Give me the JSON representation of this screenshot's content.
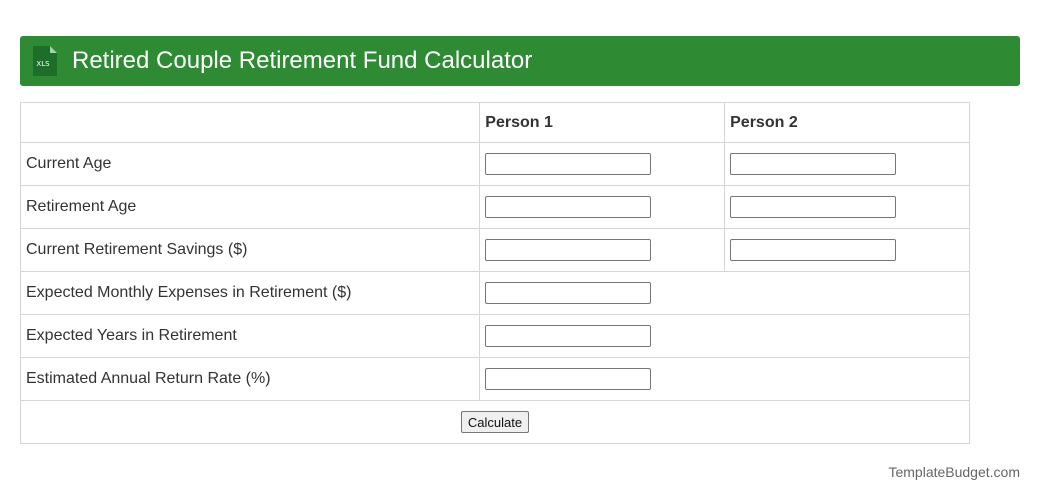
{
  "header": {
    "title": "Retired Couple Retirement Fund Calculator",
    "icon": "xls-file-icon",
    "icon_text": "XLS",
    "bg_color": "#2f8a34"
  },
  "table": {
    "columns": [
      "",
      "Person 1",
      "Person 2"
    ],
    "rows": [
      {
        "label": "Current Age",
        "person1_value": "",
        "person2_value": ""
      },
      {
        "label": "Retirement Age",
        "person1_value": "",
        "person2_value": ""
      },
      {
        "label": "Current Retirement Savings ($)",
        "person1_value": "",
        "person2_value": ""
      },
      {
        "label": "Expected Monthly Expenses in Retirement ($)",
        "value": ""
      },
      {
        "label": "Expected Years in Retirement",
        "value": ""
      },
      {
        "label": "Estimated Annual Return Rate (%)",
        "value": ""
      }
    ]
  },
  "actions": {
    "calculate_label": "Calculate"
  },
  "footer": {
    "credit": "TemplateBudget.com"
  }
}
